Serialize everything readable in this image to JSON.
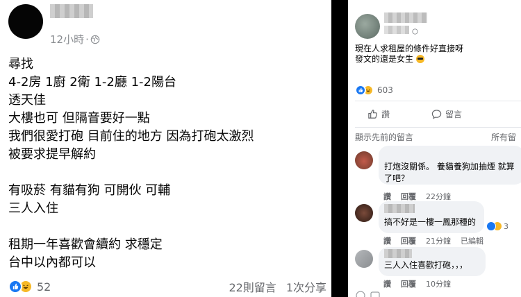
{
  "left_post": {
    "timestamp": "12小時",
    "lines": [
      "尋找",
      "4-2房 1廚 2衛 1-2廳 1-2陽台",
      "透天佳",
      "大樓也可 但隔音要好一點",
      "我們很愛打砲 目前住的地方 因為打砲太激烈",
      "被要求提早解約",
      "",
      "有吸菸 有貓有狗 可開伙 可輔",
      "三人入住",
      "",
      "租期一年喜歡會續約 求穩定",
      "台中以內都可以"
    ],
    "reaction_count": "52",
    "comments": "22則留言",
    "shares": "1次分享"
  },
  "right_post": {
    "lines": [
      "現在人求租屋的條件好直接呀",
      "發文的還是女生"
    ],
    "reaction_count": "603",
    "like_label": "讚",
    "comment_label": "留言",
    "previous_comments": "顯示先前的留言",
    "all_comments": "所有留",
    "comments": [
      {
        "lines": [
          "打炮沒關係。 養貓養狗加抽煙 就算",
          "了吧？"
        ],
        "like": "讚",
        "reply": "回覆",
        "time": "22分鐘"
      },
      {
        "lines": [
          "搞不好是一樓一鳳那種的"
        ],
        "like": "讚",
        "reply": "回覆",
        "time": "21分鐘",
        "edited": "已編輯",
        "reactions": "3"
      },
      {
        "lines": [
          "三人入住喜歡打砲，，，"
        ],
        "like": "讚",
        "reply": "回覆",
        "time": "10分鐘"
      }
    ]
  },
  "colors": {
    "like_blue": "#1877f2",
    "haha_yellow": "#f7b928",
    "secondary_text": "#65676b",
    "bubble_bg": "#f0f2f5"
  },
  "icons": [
    "globe-icon",
    "like-reaction-icon",
    "haha-reaction-icon",
    "thumbs-up-icon",
    "comment-icon",
    "cool-emoji-icon"
  ]
}
